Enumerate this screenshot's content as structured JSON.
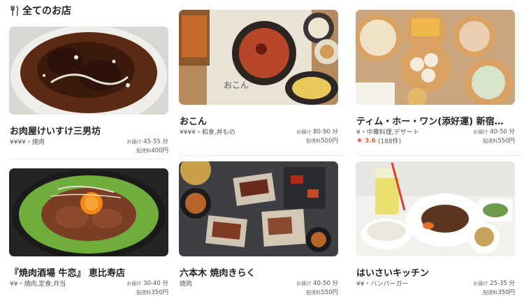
{
  "section": {
    "title": "全てのお店",
    "icon": "utensils-icon"
  },
  "restaurants": [
    {
      "name": "お肉屋けいすけ三男坊",
      "price": "¥¥¥¥",
      "meta": "・焼肉",
      "eta_label": "お届け",
      "eta": "45-55 分",
      "fee_label": "配達料",
      "fee": "400円"
    },
    {
      "name": "おこん",
      "price": "¥¥¥¥",
      "meta": "・和食,丼もの",
      "eta_label": "お届け",
      "eta": "80-90 分",
      "fee_label": "配達料",
      "fee": "500円"
    },
    {
      "name": "ティム・ホー・ワン(添好運) 新宿サザンテラス店",
      "price": "¥",
      "meta": "・中華料理,デザート",
      "rating": "3.6",
      "rating_count": "(188件)",
      "eta_label": "お届け",
      "eta": "40-50 分",
      "fee_label": "配達料",
      "fee": "550円"
    },
    {
      "name": "『焼肉酒場 牛恋』 恵比寿店",
      "price": "¥¥",
      "meta": "・焼肉,定食,弁当",
      "eta_label": "お届け",
      "eta": "30-40 分",
      "fee_label": "配達料",
      "fee": "350円"
    },
    {
      "name": "六本木 焼肉きらく",
      "price": "",
      "meta": "焼肉",
      "eta_label": "お届け",
      "eta": "40-50 分",
      "fee_label": "配達料",
      "fee": "550円"
    },
    {
      "name": "はいさいキッチン",
      "price": "¥¥",
      "meta": "・ハンバーガー",
      "eta_label": "お届け",
      "eta": "25-35 分",
      "fee_label": "配達料",
      "fee": "350円"
    }
  ],
  "colors": {
    "star": "#e0483a",
    "score": "#e06b2a",
    "text": "#222222",
    "muted": "#555555"
  }
}
